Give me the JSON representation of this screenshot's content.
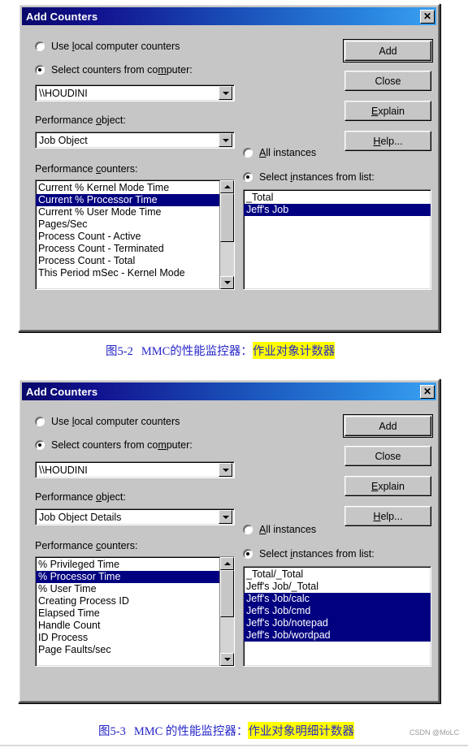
{
  "page": {
    "watermark": "CSDN @MoLC"
  },
  "dialog1": {
    "title": "Add Counters",
    "close_label": "✕",
    "radio_local": {
      "pre": "Use ",
      "acc": "l",
      "post": "ocal computer counters",
      "checked": false
    },
    "radio_remote": {
      "pre": "Select counters from co",
      "acc": "m",
      "post": "puter:",
      "checked": true
    },
    "computer_value": "\\\\HOUDINI",
    "object_label": {
      "pre": "Performance ",
      "acc": "o",
      "post": "bject:"
    },
    "object_value": "Job Object",
    "counters_label": {
      "pre": "Performance ",
      "acc": "c",
      "post": "ounters:"
    },
    "counters": [
      {
        "text": "Current % Kernel Mode Time",
        "selected": false
      },
      {
        "text": "Current % Processor Time",
        "selected": true
      },
      {
        "text": "Current % User Mode Time",
        "selected": false
      },
      {
        "text": "Pages/Sec",
        "selected": false
      },
      {
        "text": "Process Count - Active",
        "selected": false
      },
      {
        "text": "Process Count - Terminated",
        "selected": false
      },
      {
        "text": "Process Count - Total",
        "selected": false
      },
      {
        "text": "This Period mSec - Kernel Mode",
        "selected": false
      }
    ],
    "radio_all_instances": {
      "pre": "",
      "acc": "A",
      "post": "ll instances",
      "checked": false
    },
    "radio_select_instances": {
      "pre": "Select ",
      "acc": "i",
      "post": "nstances from list:",
      "checked": true
    },
    "instances": [
      {
        "text": "_Total",
        "selected": false
      },
      {
        "text": "Jeff's Job",
        "selected": true
      }
    ],
    "buttons": {
      "add": "Add",
      "close": "Close",
      "explain": {
        "pre": "",
        "acc": "E",
        "post": "xplain"
      },
      "help": {
        "pre": "",
        "acc": "H",
        "post": "elp..."
      }
    }
  },
  "caption1": {
    "prefix": "图5-2",
    "middle": "MMC的性能监控器：",
    "highlight": "作业对象计数器"
  },
  "dialog2": {
    "title": "Add Counters",
    "close_label": "✕",
    "radio_local": {
      "pre": "Use ",
      "acc": "l",
      "post": "ocal computer counters",
      "checked": false
    },
    "radio_remote": {
      "pre": "Select counters from co",
      "acc": "m",
      "post": "puter:",
      "checked": true
    },
    "computer_value": "\\\\HOUDINI",
    "object_label": {
      "pre": "Performance ",
      "acc": "o",
      "post": "bject:"
    },
    "object_value": "Job Object Details",
    "counters_label": {
      "pre": "Performance ",
      "acc": "c",
      "post": "ounters:"
    },
    "counters": [
      {
        "text": "% Privileged Time",
        "selected": false
      },
      {
        "text": "% Processor Time",
        "selected": true
      },
      {
        "text": "% User Time",
        "selected": false
      },
      {
        "text": "Creating Process ID",
        "selected": false
      },
      {
        "text": "Elapsed Time",
        "selected": false
      },
      {
        "text": "Handle Count",
        "selected": false
      },
      {
        "text": "ID Process",
        "selected": false
      },
      {
        "text": "Page Faults/sec",
        "selected": false
      }
    ],
    "radio_all_instances": {
      "pre": "",
      "acc": "A",
      "post": "ll instances",
      "checked": false
    },
    "radio_select_instances": {
      "pre": "Select ",
      "acc": "i",
      "post": "nstances from list:",
      "checked": true
    },
    "instances": [
      {
        "text": "_Total/_Total",
        "selected": false
      },
      {
        "text": "Jeff's Job/_Total",
        "selected": false
      },
      {
        "text": "Jeff's Job/calc",
        "selected": true
      },
      {
        "text": "Jeff's Job/cmd",
        "selected": true
      },
      {
        "text": "Jeff's Job/notepad",
        "selected": true
      },
      {
        "text": "Jeff's Job/wordpad",
        "selected": true
      }
    ],
    "buttons": {
      "add": "Add",
      "close": "Close",
      "explain": {
        "pre": "",
        "acc": "E",
        "post": "xplain"
      },
      "help": {
        "pre": "",
        "acc": "H",
        "post": "elp..."
      }
    }
  },
  "caption2": {
    "prefix": "图5-3",
    "middle": "MMC 的性能监控器：",
    "highlight": "作业对象明细计数器"
  }
}
